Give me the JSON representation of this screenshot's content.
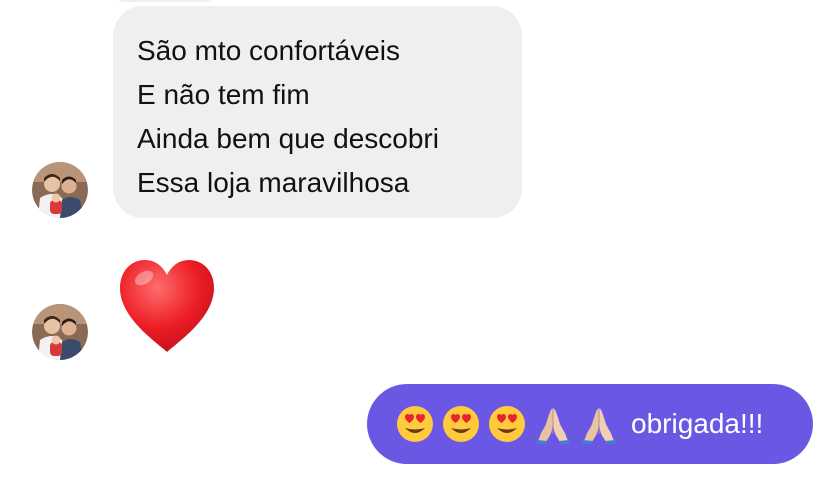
{
  "conversation": {
    "incoming_message": {
      "lines": [
        "São mto confortáveis",
        "E não tem fim",
        "Ainda bem que descobri",
        "Essa loja maravilhosa"
      ],
      "bubble_color": "#efefef"
    },
    "incoming_reaction": {
      "emoji": "heart-emoji",
      "color": "#e8242e"
    },
    "outgoing_message": {
      "emojis": [
        "heart-eyes-emoji",
        "heart-eyes-emoji",
        "heart-eyes-emoji",
        "folded-hands-emoji",
        "folded-hands-emoji"
      ],
      "text": "obrigada!!!",
      "bubble_color": "#6a58e4"
    },
    "sender_avatar": "profile-photo-avatar"
  }
}
